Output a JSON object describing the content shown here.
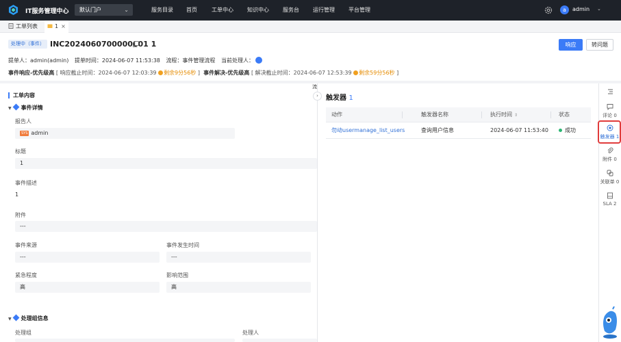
{
  "topnav": {
    "app_title": "IT服务管理中心",
    "portal": "默认门户",
    "items": [
      "服务目录",
      "首页",
      "工单中心",
      "知识中心",
      "服务台",
      "运行管理",
      "平台管理"
    ],
    "user_initial": "a",
    "user_name": "admin",
    "accent": "#3b7bf7"
  },
  "tabs": [
    {
      "label": "工单列表",
      "icon": "document-icon"
    },
    {
      "label": "1",
      "icon": "folder-icon",
      "active": true
    }
  ],
  "header": {
    "status": "处理中（事件）",
    "title": "INC2024060700000001 1",
    "respond_label": "响应",
    "transfer_label": "转问题",
    "meta": {
      "submitter": "提单人：admin(admin)",
      "submit_time": "提单时间：2024-06-07 11:53:38",
      "flow": "流程：事件管理流程",
      "current_handler": "当前处理人："
    },
    "sla": {
      "resp_title": "事件响应-优先级高",
      "resp_deadline": "[ 响应截止时间：2024-06-07 12:03:39",
      "resp_remaining": "剩余9分56秒",
      "resp_end": "]",
      "solve_title": "事件解决-优先级高",
      "solve_deadline": "[ 解决截止时间：2024-06-07 12:53:39",
      "solve_remaining": "剩余59分56秒",
      "solve_end": "]"
    }
  },
  "content": {
    "section_title": "工单内容",
    "group_event": "事件详情",
    "reporter_label": "报告人",
    "reporter_badge": "SYS",
    "reporter_value": "admin",
    "title_label": "标题",
    "title_value": "1",
    "desc_label": "事件描述",
    "desc_value": "1",
    "attach_label": "附件",
    "attach_value": "---",
    "source_label": "事件来源",
    "source_value": "---",
    "occur_label": "事件发生时间",
    "occur_value": "---",
    "urgency_label": "紧急程度",
    "urgency_value": "高",
    "impact_label": "影响范围",
    "impact_value": "高",
    "group_handler": "处理组信息",
    "handler_group_label": "处理组",
    "handler_label": "处理人"
  },
  "splitter": {
    "label": "流"
  },
  "trigger_panel": {
    "title": "触发器",
    "count": "1",
    "columns": [
      "动作",
      "触发器名称",
      "执行时间",
      "状态"
    ],
    "rows": [
      {
        "action": "勿动usermanage_list_users",
        "name": "查询用户信息",
        "time": "2024-06-07 11:53:40",
        "status": "成功"
      }
    ]
  },
  "rail": [
    {
      "label": "",
      "icon": "list-icon"
    },
    {
      "label": "评论 0",
      "icon": "comment-icon"
    },
    {
      "label": "触发器 1",
      "icon": "trigger-icon",
      "active": true
    },
    {
      "label": "附件 0",
      "icon": "paperclip-icon"
    },
    {
      "label": "关联单 0",
      "icon": "link-icon"
    },
    {
      "label": "SLA 2",
      "icon": "sla-icon"
    }
  ]
}
